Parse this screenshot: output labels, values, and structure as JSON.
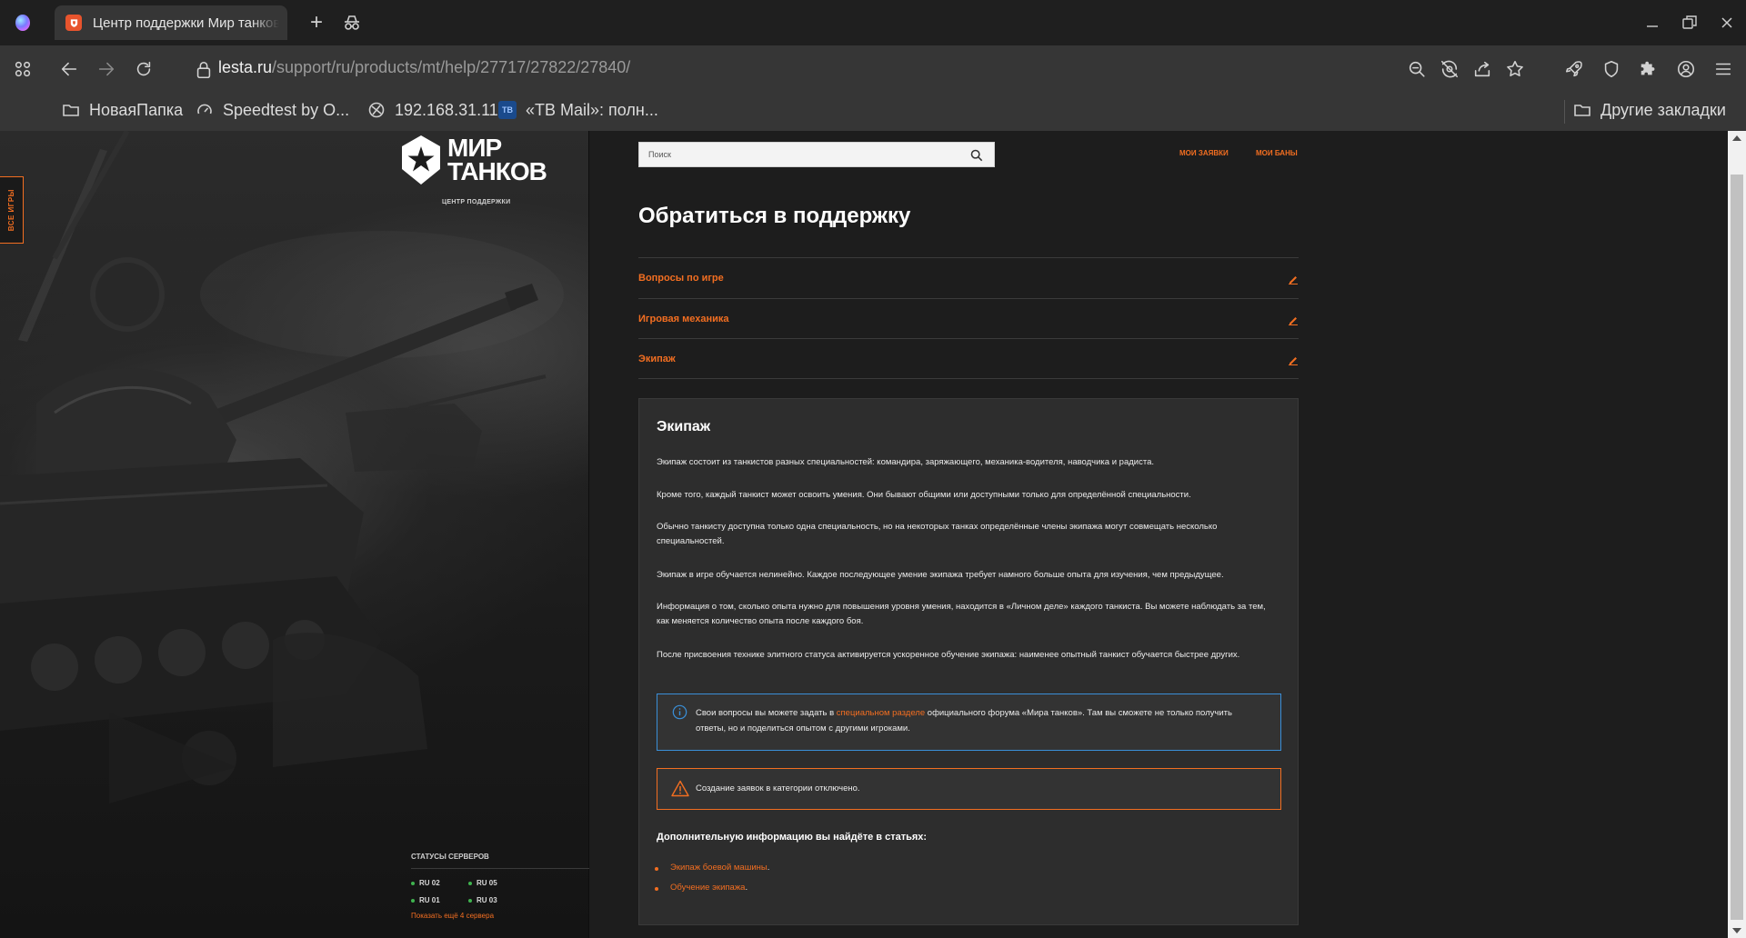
{
  "browser": {
    "tab_title": "Центр поддержки Мир танков",
    "url_host": "lesta.ru",
    "url_path": "/support/ru/products/mt/help/27717/27822/27840/",
    "bookmarks": [
      {
        "label": "НоваяПапка",
        "icon": "folder-icon"
      },
      {
        "label": "Speedtest by O...",
        "icon": "speedtest-icon"
      },
      {
        "label": "192.168.31.11",
        "icon": "router-icon"
      },
      {
        "label": "«ТВ Mail»: полн...",
        "icon": "tv-mail-icon"
      }
    ],
    "other_bookmarks": "Другие закладки"
  },
  "sidebar": {
    "all_games": "ВСЕ ИГРЫ",
    "logo_line1": "МИР",
    "logo_line2": "ТАНКОВ",
    "logo_sub": "ЦЕНТР ПОДДЕРЖКИ",
    "server_status_title": "СТАТУСЫ СЕРВЕРОВ",
    "servers": [
      "RU 02",
      "RU 05",
      "RU 01",
      "RU 03"
    ],
    "show_more": "Показать ещё 4 сервера"
  },
  "header": {
    "search_placeholder": "Поиск",
    "my_requests": "МОИ ЗАЯВКИ",
    "my_bans": "МОИ БАНЫ"
  },
  "main": {
    "title": "Обратиться в поддержку",
    "breadcrumb_rows": [
      "Вопросы по игре",
      "Игровая механика",
      "Экипаж"
    ],
    "article": {
      "heading": "Экипаж",
      "paragraphs": [
        "Экипаж состоит из танкистов разных специальностей: командира, заряжающего, механика-водителя, наводчика и радиста.",
        "Кроме того, каждый танкист может освоить умения. Они бывают общими или доступными только для определённой специальности.",
        "Обычно танкисту доступна только одна специальность, но на некоторых танках определённые члены экипажа могут совмещать несколько специальностей.",
        "Экипаж в игре обучается нелинейно. Каждое последующее умение экипажа требует намного больше опыта для изучения, чем предыдущее.",
        "Информация о том, сколько опыта нужно для повышения уровня умения, находится в «Личном деле» каждого танкиста. Вы можете наблюдать за тем, как меняется количество опыта после каждого боя.",
        "После присвоения технике элитного статуса активируется ускоренное обучение экипажа: наименее опытный танкист обучается быстрее других."
      ],
      "info_before": "Свои вопросы вы можете задать в ",
      "info_link": "специальном разделе",
      "info_after": " официального форума «Мира танков». Там вы сможете не только получить ответы, но и поделиться опытом с другими игроками.",
      "warning": "Создание заявок в категории отключено.",
      "more_title": "Дополнительную информацию вы найдёте в статьях:",
      "links": [
        "Экипаж боевой машины",
        "Обучение экипажа"
      ]
    }
  },
  "colors": {
    "accent": "#f26e21",
    "info_border": "#3a8fd8",
    "server_ok": "#3fb34f"
  }
}
